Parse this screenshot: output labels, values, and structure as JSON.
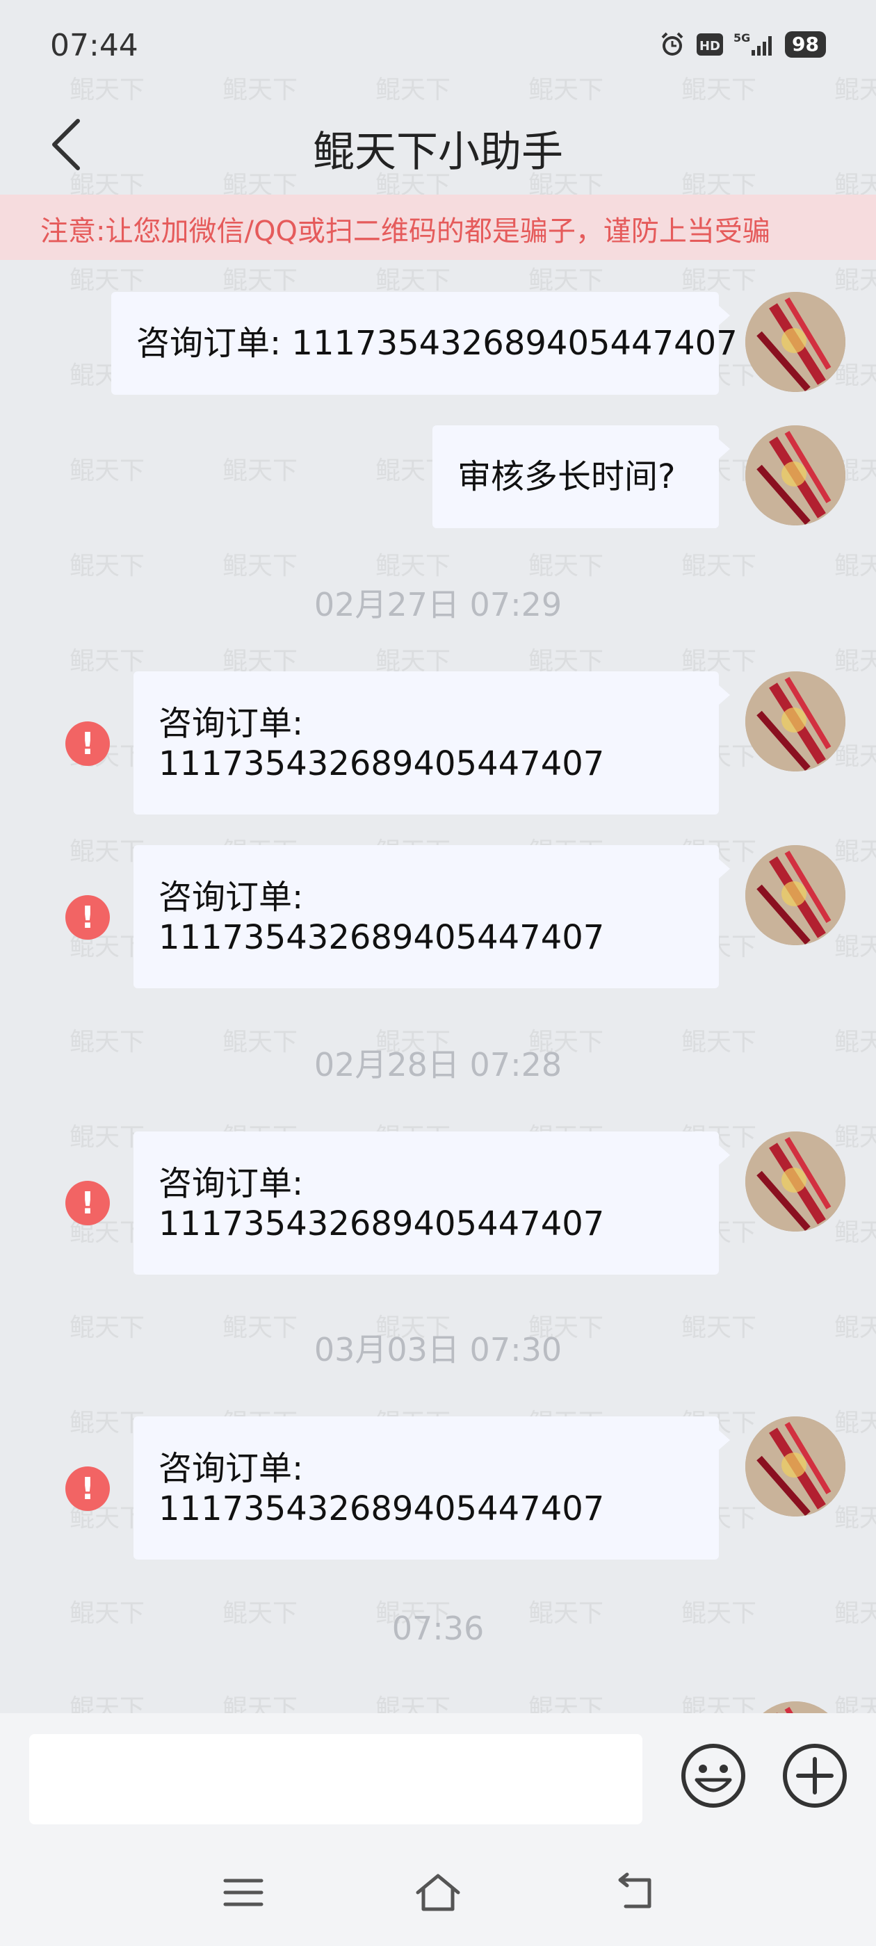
{
  "status_bar": {
    "time": "07:44",
    "icons": [
      "alarm-icon",
      "hd-icon",
      "5g-signal-icon"
    ],
    "battery": "98"
  },
  "header": {
    "title": "鲲天下小助手",
    "back_icon": "chevron-left-icon"
  },
  "notice": {
    "text": "注意:让您加微信/QQ或扫二维码的都是骗子，谨防上当受骗",
    "color": "#e55b5b"
  },
  "watermark": {
    "text": "鲲天下"
  },
  "messages": [
    {
      "lines": [
        "咨询订单: 1117354326894054474​07"
      ],
      "failed": false
    },
    {
      "lines": [
        "审核多长时间?"
      ],
      "failed": false
    },
    {
      "lines": [
        "咨询订单:",
        "1117354326894054474​07"
      ],
      "failed": true
    },
    {
      "lines": [
        "咨询订单:",
        "1117354326894054474​07"
      ],
      "failed": true
    },
    {
      "lines": [
        "咨询订单:",
        "1117354326894054474​07"
      ],
      "failed": true
    },
    {
      "lines": [
        "咨询订单:",
        "1117354326894054474​07"
      ],
      "failed": true
    }
  ],
  "timestamps": [
    "02月27日 07:29",
    "02月28日 07:28",
    "03月03日 07:30",
    "07:36"
  ],
  "error_glyph": "!",
  "input": {
    "placeholder": "",
    "value": ""
  },
  "input_bar": {
    "emoji_icon": "smiley-icon",
    "plus_icon": "plus-circle-icon"
  },
  "nav_bar": {
    "icons": [
      "menu-icon",
      "home-icon",
      "back-icon"
    ]
  },
  "colors": {
    "background": "#e9ebee",
    "bubble": "#f5f7ff",
    "error": "#f26464",
    "notice_bg": "#f6dcde"
  }
}
